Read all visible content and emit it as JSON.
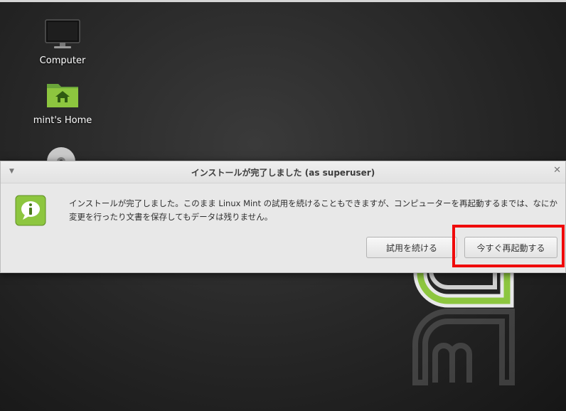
{
  "desktop": {
    "icons": [
      {
        "label": "Computer",
        "icon": "monitor-icon"
      },
      {
        "label": "mint's Home",
        "icon": "home-folder-icon"
      },
      {
        "label": "",
        "icon": "disc-icon"
      }
    ]
  },
  "dialog": {
    "title": "インストールが完了しました (as superuser)",
    "message": "インストールが完了しました。このまま Linux Mint の試用を続けることもできますが、コンピューターを再起動するまでは、なにか変更を行ったり文書を保存してもデータは残りません。",
    "icon": "info-icon",
    "buttons": {
      "continue": "試用を続ける",
      "restart": "今すぐ再起動する"
    }
  },
  "colors": {
    "highlight": "#f00a0a",
    "mint_green": "#8dc63f"
  }
}
